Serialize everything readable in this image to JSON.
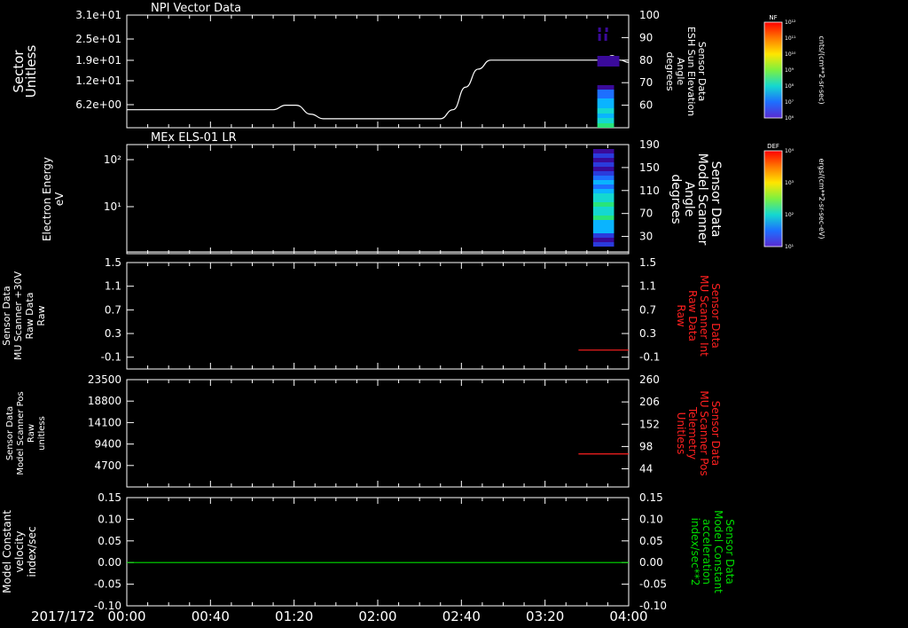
{
  "colors": {
    "background": "#000000",
    "axis": "#ffffff",
    "red": "#ff2020",
    "green": "#00dd00",
    "spectrogram": [
      "#3a0a9a",
      "#2a3bdc",
      "#1d6fff",
      "#0ab4ff",
      "#14d8d0",
      "#28e47a",
      "#7cf040"
    ]
  },
  "chart_data": [
    {
      "type": "line",
      "panel_title": "NPI Vector Data",
      "ylabel": [
        "Sector",
        "Unitless"
      ],
      "yticks": [
        "3.1e+01",
        "2.5e+01",
        "1.9e+01",
        "1.2e+01",
        "6.2e+00"
      ],
      "right_ylabel": [
        "Sensor Data",
        "ESH Sun Elevation",
        "Angle",
        "degrees"
      ],
      "right_yticks": [
        100,
        90,
        80,
        70,
        60
      ],
      "right_ylim": [
        50,
        100
      ],
      "series": [
        {
          "axis": "right",
          "x": [
            "00:00",
            "01:00",
            "01:10",
            "01:16",
            "01:21",
            "01:28",
            "01:34",
            "02:30",
            "02:36",
            "02:42",
            "02:48",
            "02:54",
            "03:40",
            "03:45",
            "03:49",
            "03:52",
            "03:56",
            "04:00"
          ],
          "y": [
            58,
            58,
            58,
            60,
            60,
            56,
            54,
            54,
            58,
            68,
            76,
            80,
            80,
            80,
            81,
            82,
            80,
            79
          ]
        }
      ],
      "colorbar": {
        "label": "NF",
        "units": "cnts/(cm**2-sr-sec)",
        "ticks": [
          "10¹²",
          "10¹¹",
          "10¹⁰",
          "10⁹",
          "10⁸",
          "10⁷",
          "10⁶"
        ]
      }
    },
    {
      "type": "heatmap",
      "panel_title": "MEx ELS-01 LR",
      "ylabel": [
        "Electron Energy",
        "eV"
      ],
      "yticks": [
        "10²",
        "10¹"
      ],
      "yscale": "log",
      "right_ylabel": [
        "Sensor Data",
        "Model Scanner",
        "Angle",
        "degrees"
      ],
      "right_yticks": [
        190,
        150,
        110,
        70,
        30
      ],
      "right_ylim": [
        0,
        190
      ],
      "series": [
        {
          "axis": "right",
          "x": [
            "00:00",
            "04:00"
          ],
          "y": [
            3,
            3
          ]
        }
      ],
      "colorbar": {
        "label": "DEF",
        "units": "ergs/(cm**2-sr-sec-eV)",
        "ticks": [
          "10⁴",
          "10³",
          "10²",
          "10¹"
        ]
      }
    },
    {
      "type": "line",
      "ylabel": [
        "Sensor Data",
        "MU Scanner +30V",
        "Raw Data",
        "Raw"
      ],
      "yticks": [
        "1.5",
        "1.1",
        "0.7",
        "0.3",
        "-0.1"
      ],
      "ylim": [
        -0.3,
        1.5
      ],
      "right_ylabel": [
        "Sensor Data",
        "MU Scanner Int",
        "Raw Data",
        "Raw"
      ],
      "right_yticks": [
        "1.5",
        "1.1",
        "0.7",
        "0.3",
        "-0.1"
      ],
      "right_ylim": [
        -0.3,
        1.5
      ],
      "series": [
        {
          "axis": "right",
          "x": [
            "03:36",
            "04:00"
          ],
          "y": [
            0.02,
            0.02
          ]
        }
      ]
    },
    {
      "type": "line",
      "ylabel": [
        "Sensor Data",
        "Model Scanner Pos",
        "Raw",
        "unitless"
      ],
      "yticks": [
        "23500",
        "18800",
        "14100",
        "9400",
        "4700"
      ],
      "ylim": [
        0,
        23500
      ],
      "right_ylabel": [
        "Sensor Data",
        "MU Scanner Pos",
        "Telemetry",
        "Unitless"
      ],
      "right_yticks": [
        260,
        206,
        152,
        98,
        44
      ],
      "right_ylim": [
        0,
        260
      ],
      "series": [
        {
          "axis": "right",
          "x": [
            "03:36",
            "04:00"
          ],
          "y": [
            80,
            80
          ]
        }
      ]
    },
    {
      "type": "line",
      "ylabel": [
        "Sensor Data",
        "Model Constant",
        "velocity",
        "index/sec"
      ],
      "yticks": [
        "0.15",
        "0.10",
        "0.05",
        "0.00",
        "-0.05",
        "-0.10"
      ],
      "ylim": [
        -0.1,
        0.15
      ],
      "right_ylabel": [
        "Sensor Data",
        "Model Constant",
        "acceleration",
        "index/sec**2"
      ],
      "right_yticks": [
        "0.15",
        "0.10",
        "0.05",
        "0.00",
        "-0.05",
        "-0.10"
      ],
      "right_ylim": [
        -0.1,
        0.15
      ],
      "series": [
        {
          "axis": "left",
          "x": [
            "00:00",
            "04:00"
          ],
          "y": [
            0,
            0
          ]
        }
      ]
    }
  ],
  "xaxis": {
    "date": "2017/172",
    "ticks": [
      "00:00",
      "00:40",
      "01:20",
      "02:00",
      "02:40",
      "03:20",
      "04:00"
    ]
  }
}
